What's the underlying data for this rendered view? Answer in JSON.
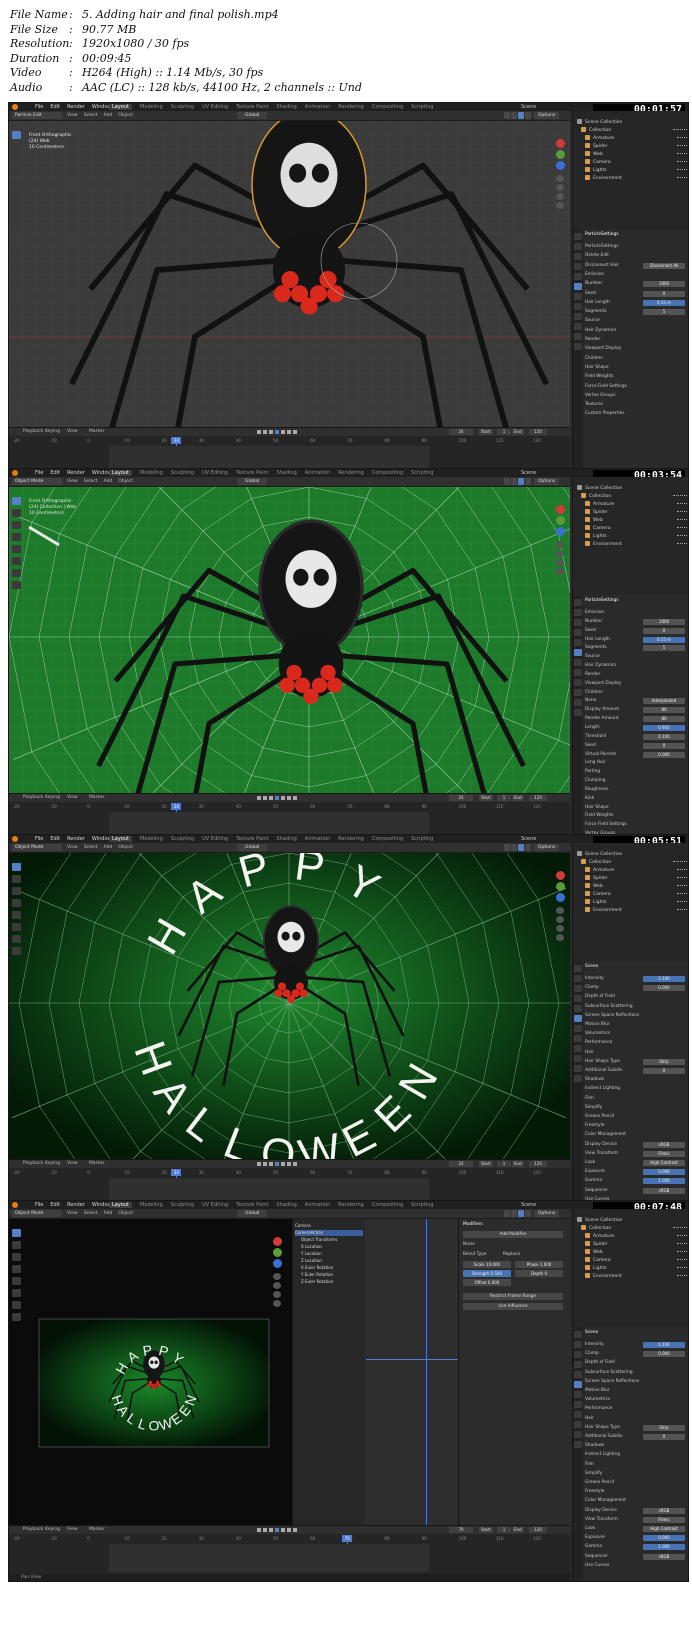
{
  "file_info": {
    "rows": [
      {
        "label": "File Name",
        "value": "5. Adding hair and final polish.mp4"
      },
      {
        "label": "File Size",
        "value": "90.77 MB"
      },
      {
        "label": "Resolution",
        "value": "1920x1080 / 30 fps"
      },
      {
        "label": "Duration",
        "value": "00:09:45"
      },
      {
        "label": "Video",
        "value": "H264 (High) :: 1.14 Mb/s, 30 fps"
      },
      {
        "label": "Audio",
        "value": "AAC (LC) :: 128 kb/s, 44100 Hz, 2 channels :: Und"
      }
    ]
  },
  "app": {
    "menus": [
      "File",
      "Edit",
      "Render",
      "Window",
      "Help"
    ],
    "workspaces": [
      "Layout",
      "Modeling",
      "Sculpting",
      "UV Editing",
      "Texture Paint",
      "Shading",
      "Animation",
      "Rendering",
      "Compositing",
      "Scripting"
    ],
    "scene_label": "Scene",
    "view_layer_label": "View Layer",
    "viewport_header": [
      "View",
      "Select",
      "Add",
      "Object"
    ],
    "options_label": "Options",
    "global_label": "Global",
    "timeline": {
      "menu": [
        "Playback",
        "Keying",
        "View",
        "Marker"
      ],
      "start_label": "Start",
      "end_label": "End",
      "start": "1",
      "end": "120",
      "ruler": [
        "-20",
        "-10",
        "0",
        "10",
        "20",
        "30",
        "40",
        "50",
        "60",
        "70",
        "80",
        "90",
        "100",
        "110",
        "120"
      ]
    }
  },
  "frames": [
    {
      "timestamp": "00:01:57",
      "mode": "Particle Edit",
      "viewport_info": [
        "Front Orthographic",
        "(24) Web",
        "10 Centimeters"
      ],
      "current_frame": "24",
      "outliner": [
        "Scene Collection",
        "Collection",
        "Armature",
        "Spider",
        "Web",
        "Camera",
        "Lights",
        "Environment"
      ],
      "props_header": "ParticleSettings",
      "props": [
        {
          "label": "ParticleSettings",
          "value": ""
        },
        {
          "label": "Delete Edit",
          "value": ""
        },
        {
          "label": "Disconnect Hair",
          "value": "Disconnect All"
        },
        {
          "label": "Emission",
          "value": ""
        },
        {
          "label": "Number",
          "value": "1000"
        },
        {
          "label": "Seed",
          "value": "0"
        },
        {
          "label": "Hair Length",
          "value": "0.15 m"
        },
        {
          "label": "Segments",
          "value": "5"
        },
        {
          "label": "Source",
          "value": ""
        },
        {
          "label": "Hair Dynamics",
          "value": ""
        },
        {
          "label": "Render",
          "value": ""
        },
        {
          "label": "Viewport Display",
          "value": ""
        },
        {
          "label": "Children",
          "value": ""
        },
        {
          "label": "Hair Shape",
          "value": ""
        },
        {
          "label": "Field Weights",
          "value": ""
        },
        {
          "label": "Force Field Settings",
          "value": ""
        },
        {
          "label": "Vertex Groups",
          "value": ""
        },
        {
          "label": "Textures",
          "value": ""
        },
        {
          "label": "Custom Properties",
          "value": ""
        }
      ],
      "status": [
        "Brush Edit",
        "Pan View",
        "Set 3D Cursor",
        "Menu"
      ]
    },
    {
      "timestamp": "00:03:54",
      "mode": "Object Mode",
      "viewport_info": [
        "Front Orthographic",
        "(24) Collection | Web",
        "10 Centimeters"
      ],
      "current_frame": "24",
      "outliner": [
        "Scene Collection",
        "Collection",
        "Armature",
        "Spider",
        "Web",
        "Camera",
        "Lights",
        "Environment"
      ],
      "props_header": "ParticleSettings",
      "props": [
        {
          "label": "Emission",
          "value": ""
        },
        {
          "label": "Number",
          "value": "1000"
        },
        {
          "label": "Seed",
          "value": "0"
        },
        {
          "label": "Hair Length",
          "value": "0.15 m"
        },
        {
          "label": "Segments",
          "value": "5"
        },
        {
          "label": "Source",
          "value": ""
        },
        {
          "label": "Hair Dynamics",
          "value": ""
        },
        {
          "label": "Render",
          "value": ""
        },
        {
          "label": "Viewport Display",
          "value": ""
        },
        {
          "label": "Children",
          "value": ""
        },
        {
          "label": "None",
          "value": "Interpolated"
        },
        {
          "label": "Display Amount",
          "value": "80"
        },
        {
          "label": "Render Amount",
          "value": "80"
        },
        {
          "label": "Length",
          "value": "0.950"
        },
        {
          "label": "Threshold",
          "value": "0.100"
        },
        {
          "label": "Seed",
          "value": "0"
        },
        {
          "label": "Virtual Parents",
          "value": "0.000"
        },
        {
          "label": "Long Hair",
          "value": ""
        },
        {
          "label": "Parting",
          "value": ""
        },
        {
          "label": "Clumping",
          "value": ""
        },
        {
          "label": "Roughness",
          "value": ""
        },
        {
          "label": "Kink",
          "value": ""
        },
        {
          "label": "Hair Shape",
          "value": ""
        },
        {
          "label": "Field Weights",
          "value": ""
        },
        {
          "label": "Force Field Settings",
          "value": ""
        },
        {
          "label": "Vertex Groups",
          "value": ""
        }
      ],
      "status": [
        "Select",
        "Box Select",
        "Rotate View",
        "Object Context Menu"
      ]
    },
    {
      "timestamp": "00:05:51",
      "mode": "Object Mode",
      "viewport_info": [],
      "current_frame": "24",
      "overlay_text_top": "HAPPY",
      "overlay_text_bottom": "HALLOWEEN",
      "outliner": [
        "Scene Collection",
        "Collection",
        "Armature",
        "Spider",
        "Web",
        "Camera",
        "Lights",
        "Environment"
      ],
      "props_header": "Scene",
      "props": [
        {
          "label": "Intensity",
          "value": "0.100"
        },
        {
          "label": "Clamp",
          "value": "0.000"
        },
        {
          "label": "Depth of Field",
          "value": ""
        },
        {
          "label": "Subsurface Scattering",
          "value": ""
        },
        {
          "label": "Screen Space Reflections",
          "value": ""
        },
        {
          "label": "Motion Blur",
          "value": ""
        },
        {
          "label": "Volumetrics",
          "value": ""
        },
        {
          "label": "Performance",
          "value": ""
        },
        {
          "label": "Hair",
          "value": ""
        },
        {
          "label": "Hair Shape Type",
          "value": "Strip"
        },
        {
          "label": "Additional Subdiv",
          "value": "0"
        },
        {
          "label": "Shadows",
          "value": ""
        },
        {
          "label": "Indirect Lighting",
          "value": ""
        },
        {
          "label": "Film",
          "value": ""
        },
        {
          "label": "Simplify",
          "value": ""
        },
        {
          "label": "Grease Pencil",
          "value": ""
        },
        {
          "label": "Freestyle",
          "value": ""
        },
        {
          "label": "Color Management",
          "value": ""
        },
        {
          "label": "Display Device",
          "value": "sRGB"
        },
        {
          "label": "View Transform",
          "value": "Filmic"
        },
        {
          "label": "Look",
          "value": "High Contrast"
        },
        {
          "label": "Exposure",
          "value": "0.000"
        },
        {
          "label": "Gamma",
          "value": "1.000"
        },
        {
          "label": "Sequencer",
          "value": "sRGB"
        },
        {
          "label": "Use Curves",
          "value": ""
        }
      ],
      "status": [
        "Select",
        "Box Select",
        "Rotate View",
        "Object Context Menu"
      ]
    },
    {
      "timestamp": "00:07:48",
      "mode": "Object Mode",
      "viewport_info": [],
      "current_frame": "70",
      "overlay_text_top": "HAPPY",
      "overlay_text_bottom": "HALLOWEEN",
      "anim_channels": [
        "Camera",
        "CameraAction",
        "Object Transforms",
        "X Location",
        "Y Location",
        "Z Location",
        "X Euler Rotation",
        "Y Euler Rotation",
        "Z Euler Rotation"
      ],
      "modifiers": {
        "title": "Modifiers",
        "add": "Add Modifier",
        "name": "Noise",
        "blend_type_label": "Blend Type",
        "blend_type": "Replace",
        "fields": [
          "Scale 10.000",
          "Phase 1.000",
          "Strength 0.500",
          "Depth 0",
          "Offset 0.000"
        ],
        "restrict": "Restrict Frame Range",
        "influence": "Use Influence"
      },
      "outliner": [
        "Scene Collection",
        "Collection",
        "Armature",
        "Spider",
        "Web",
        "Camera",
        "Lights",
        "Environment"
      ],
      "props_header": "Scene",
      "props": [
        {
          "label": "Intensity",
          "value": "0.100"
        },
        {
          "label": "Clamp",
          "value": "0.000"
        },
        {
          "label": "Depth of Field",
          "value": ""
        },
        {
          "label": "Subsurface Scattering",
          "value": ""
        },
        {
          "label": "Screen Space Reflections",
          "value": ""
        },
        {
          "label": "Motion Blur",
          "value": ""
        },
        {
          "label": "Volumetrics",
          "value": ""
        },
        {
          "label": "Performance",
          "value": ""
        },
        {
          "label": "Hair",
          "value": ""
        },
        {
          "label": "Hair Shape Type",
          "value": "Strip"
        },
        {
          "label": "Additional Subdiv",
          "value": "0"
        },
        {
          "label": "Shadows",
          "value": ""
        },
        {
          "label": "Indirect Lighting",
          "value": ""
        },
        {
          "label": "Film",
          "value": ""
        },
        {
          "label": "Simplify",
          "value": ""
        },
        {
          "label": "Grease Pencil",
          "value": ""
        },
        {
          "label": "Freestyle",
          "value": ""
        },
        {
          "label": "Color Management",
          "value": ""
        },
        {
          "label": "Display Device",
          "value": "sRGB"
        },
        {
          "label": "View Transform",
          "value": "Filmic"
        },
        {
          "label": "Look",
          "value": "High Contrast"
        },
        {
          "label": "Exposure",
          "value": "0.000"
        },
        {
          "label": "Gamma",
          "value": "1.000"
        },
        {
          "label": "Sequencer",
          "value": "sRGB"
        },
        {
          "label": "Use Curves",
          "value": ""
        }
      ],
      "status": [
        "Pan View"
      ]
    }
  ],
  "colors": {
    "ui_dark": "#2b2b2b",
    "selection_blue": "#4772b3",
    "green_background": "#1f7a2e",
    "spider_red": "#d9291c"
  }
}
